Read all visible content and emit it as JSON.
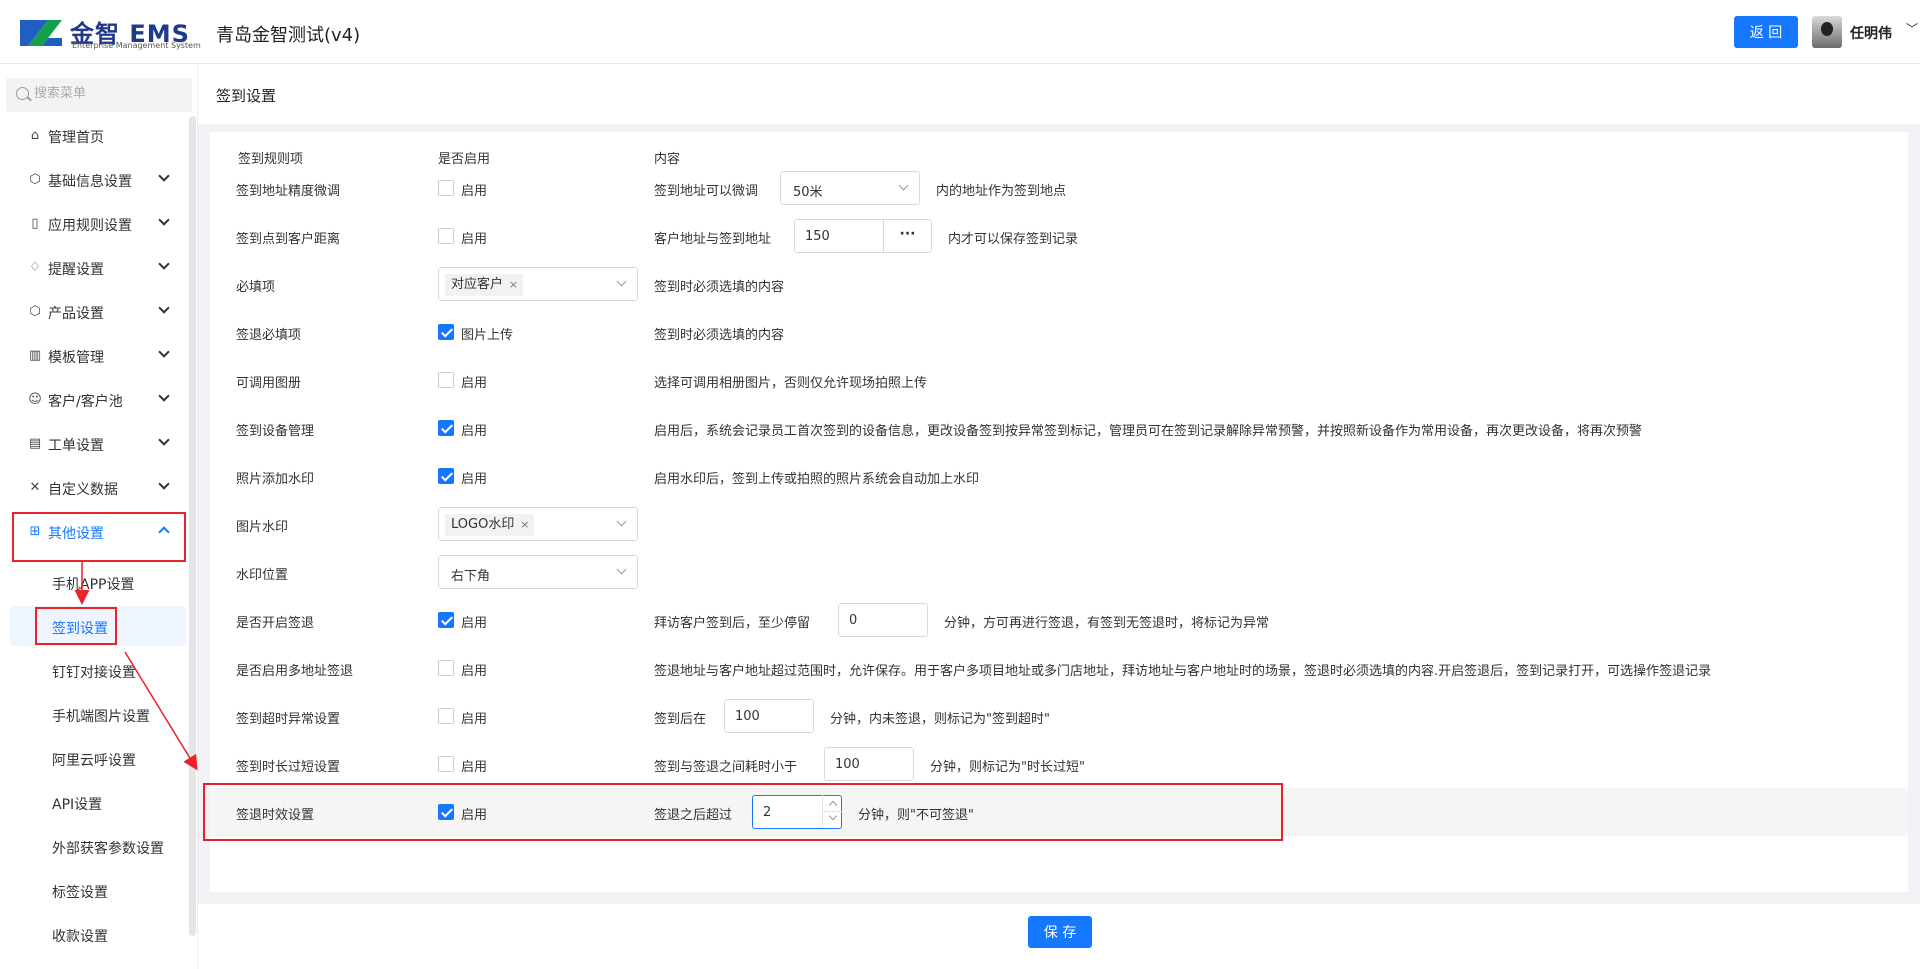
{
  "header": {
    "logo_title": "金智 EMS",
    "logo_subtitle": "Enterprise Management System",
    "app_title": "青岛金智测试(v4)",
    "back_label": "返 回",
    "user_name": "任明伟",
    "brand_color": "#1677ff"
  },
  "sidebar": {
    "search_placeholder": "搜索菜单",
    "items": [
      {
        "label": "管理首页",
        "icon": "home-icon"
      },
      {
        "label": "基础信息设置",
        "icon": "cube-icon"
      },
      {
        "label": "应用规则设置",
        "icon": "document-icon"
      },
      {
        "label": "提醒设置",
        "icon": "bell-icon"
      },
      {
        "label": "产品设置",
        "icon": "box-icon"
      },
      {
        "label": "模板管理",
        "icon": "template-icon"
      },
      {
        "label": "客户/客户池",
        "icon": "users-icon"
      },
      {
        "label": "工单设置",
        "icon": "ticket-icon"
      },
      {
        "label": "自定义数据",
        "icon": "tools-icon"
      },
      {
        "label": "其他设置",
        "icon": "grid-icon"
      }
    ],
    "sub_items": [
      {
        "label": "手机APP设置"
      },
      {
        "label": "签到设置"
      },
      {
        "label": "钉钉对接设置"
      },
      {
        "label": "手机端图片设置"
      },
      {
        "label": "阿里云呼设置"
      },
      {
        "label": "API设置"
      },
      {
        "label": "外部获客参数设置"
      },
      {
        "label": "标签设置"
      },
      {
        "label": "收款设置"
      }
    ]
  },
  "page": {
    "title": "签到设置",
    "col_rule": "签到规则项",
    "col_enabled": "是否启用",
    "col_content": "内容",
    "save_label": "保 存"
  },
  "rows": {
    "r1": {
      "label": "签到地址精度微调",
      "cb": "启用",
      "text1": "签到地址可以微调",
      "select": "50米",
      "text2": "内的地址作为签到地点"
    },
    "r2": {
      "label": "签到点到客户距离",
      "cb": "启用",
      "text1": "客户地址与签到地址",
      "input": "150",
      "more": "···",
      "text2": "内才可以保存签到记录"
    },
    "r3": {
      "label": "必填项",
      "tag": "对应客户",
      "text1": "签到时必须选填的内容"
    },
    "r4": {
      "label": "签退必填项",
      "cb": "图片上传",
      "text1": "签到时必须选填的内容"
    },
    "r5": {
      "label": "可调用图册",
      "cb": "启用",
      "text1": "选择可调用相册图片，否则仅允许现场拍照上传"
    },
    "r6": {
      "label": "签到设备管理",
      "cb": "启用",
      "text1": "启用后，系统会记录员工首次签到的设备信息，更改设备签到按异常签到标记，管理员可在签到记录解除异常预警，并按照新设备作为常用设备，再次更改设备，将再次预警"
    },
    "r7": {
      "label": "照片添加水印",
      "cb": "启用",
      "text1": "启用水印后，签到上传或拍照的照片系统会自动加上水印"
    },
    "r8": {
      "label": "图片水印",
      "tag": "LOGO水印"
    },
    "r9": {
      "label": "水印位置",
      "select": "右下角"
    },
    "r10": {
      "label": "是否开启签退",
      "cb": "启用",
      "text1": "拜访客户签到后，至少停留",
      "input": "0",
      "text2": "分钟，方可再进行签退，有签到无签退时，将标记为异常"
    },
    "r11": {
      "label": "是否启用多地址签退",
      "cb": "启用",
      "text1": "签退地址与客户地址超过范围时，允许保存。用于客户多项目地址或多门店地址，拜访地址与客户地址时的场景，签退时必须选填的内容.开启签退后，签到记录打开，可选操作签退记录"
    },
    "r12": {
      "label": "签到超时异常设置",
      "cb": "启用",
      "text1": "签到后在",
      "input": "100",
      "text2": "分钟，内未签退，则标记为\"签到超时\""
    },
    "r13": {
      "label": "签到时长过短设置",
      "cb": "启用",
      "text1": "签到与签退之间耗时小于",
      "input": "100",
      "text2": "分钟，则标记为\"时长过短\""
    },
    "r14": {
      "label": "签退时效设置",
      "cb": "启用",
      "text1": "签退之后超过",
      "input": "2",
      "text2": "分钟，则\"不可签退\""
    }
  }
}
